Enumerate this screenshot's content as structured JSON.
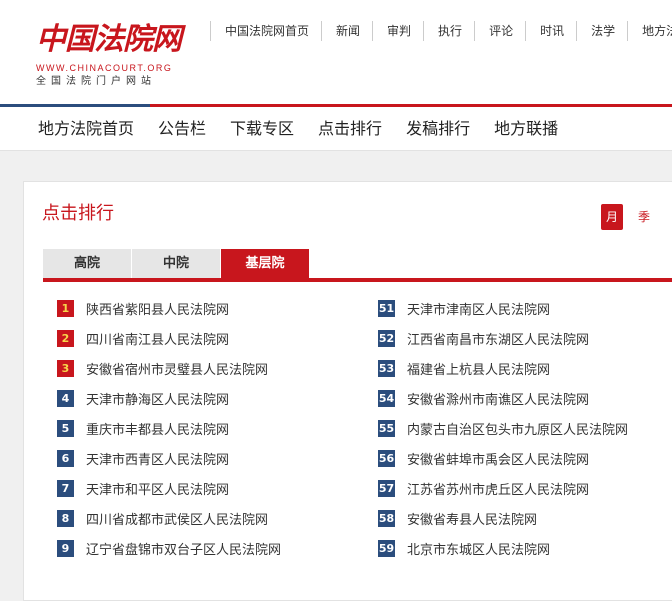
{
  "logo": {
    "brand": "中国法院网",
    "url": "WWW.CHINACOURT.ORG",
    "subtitle": "全国法院门户网站"
  },
  "topnav": [
    "中国法院网首页",
    "新闻",
    "审判",
    "执行",
    "评论",
    "时讯",
    "法学",
    "地方法院"
  ],
  "mainnav": [
    "地方法院首页",
    "公告栏",
    "下载专区",
    "点击排行",
    "发稿排行",
    "地方联播"
  ],
  "panel": {
    "title": "点击排行",
    "period_month": "月",
    "period_quarter": "季"
  },
  "tabs": [
    {
      "label": "高院",
      "active": false
    },
    {
      "label": "中院",
      "active": false
    },
    {
      "label": "基层院",
      "active": true
    }
  ],
  "ranking_left": [
    {
      "rank": "1",
      "name": "陕西省紫阳县人民法院网"
    },
    {
      "rank": "2",
      "name": "四川省南江县人民法院网"
    },
    {
      "rank": "3",
      "name": "安徽省宿州市灵璧县人民法院网"
    },
    {
      "rank": "4",
      "name": "天津市静海区人民法院网"
    },
    {
      "rank": "5",
      "name": "重庆市丰都县人民法院网"
    },
    {
      "rank": "6",
      "name": "天津市西青区人民法院网"
    },
    {
      "rank": "7",
      "name": "天津市和平区人民法院网"
    },
    {
      "rank": "8",
      "name": "四川省成都市武侯区人民法院网"
    },
    {
      "rank": "9",
      "name": "辽宁省盘锦市双台子区人民法院网"
    }
  ],
  "ranking_right": [
    {
      "rank": "51",
      "name": "天津市津南区人民法院网"
    },
    {
      "rank": "52",
      "name": "江西省南昌市东湖区人民法院网"
    },
    {
      "rank": "53",
      "name": "福建省上杭县人民法院网"
    },
    {
      "rank": "54",
      "name": "安徽省滁州市南谯区人民法院网"
    },
    {
      "rank": "55",
      "name": "内蒙古自治区包头市九原区人民法院网"
    },
    {
      "rank": "56",
      "name": "安徽省蚌埠市禹会区人民法院网"
    },
    {
      "rank": "57",
      "name": "江苏省苏州市虎丘区人民法院网"
    },
    {
      "rank": "58",
      "name": "安徽省寿县人民法院网"
    },
    {
      "rank": "59",
      "name": "北京市东城区人民法院网"
    }
  ]
}
